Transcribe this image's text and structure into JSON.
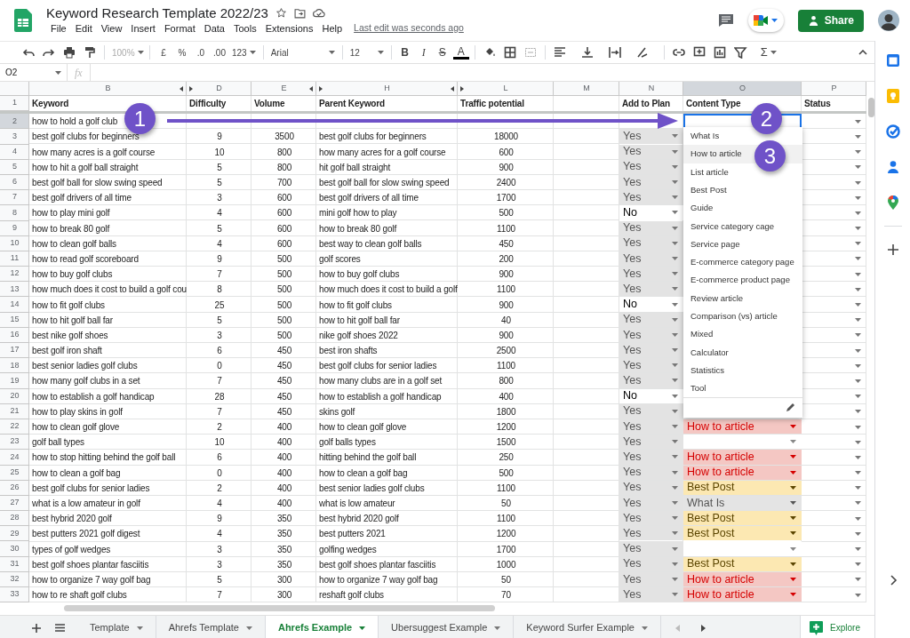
{
  "app": {
    "title": "Keyword Research Template 2022/23",
    "menu": [
      "File",
      "Edit",
      "View",
      "Insert",
      "Format",
      "Data",
      "Tools",
      "Extensions",
      "Help"
    ],
    "last_edit": "Last edit was seconds ago",
    "share": "Share"
  },
  "toolbar": {
    "zoom": "100%",
    "currency": "£",
    "percent": "%",
    "decimal_less": ".0",
    "decimal_more": ".00",
    "number_format": "123",
    "font": "Arial",
    "font_size": "12",
    "bold": "B",
    "italic": "I",
    "strike": "S",
    "text_color": "A",
    "sum": "Σ"
  },
  "formula_bar": {
    "cell_ref": "O2",
    "fx": "fx"
  },
  "sheet": {
    "columns": [
      {
        "letter": "B",
        "selected": false
      },
      {
        "letter": "D",
        "selected": false
      },
      {
        "letter": "E",
        "selected": false
      },
      {
        "letter": "H",
        "selected": false
      },
      {
        "letter": "L",
        "selected": false
      },
      {
        "letter": "M",
        "selected": false
      },
      {
        "letter": "N",
        "selected": false
      },
      {
        "letter": "O",
        "selected": true
      },
      {
        "letter": "P",
        "selected": false
      }
    ],
    "header_row": {
      "number": "1",
      "keyword": "Keyword",
      "difficulty": "Difficulty",
      "volume": "Volume",
      "parent": "Parent Keyword",
      "traffic": "Traffic potential",
      "plan": "Add to Plan",
      "content": "Content Type",
      "status": "Status"
    },
    "rows": [
      {
        "number": "2",
        "selected": true,
        "keyword": "how to hold a golf club"
      },
      {
        "number": "3",
        "selected": false,
        "keyword": "best golf clubs for beginners",
        "difficulty": "9",
        "volume": "3500",
        "parent": "best golf clubs for beginners",
        "traffic": "18000",
        "plan": {
          "text": "Yes",
          "shaded": true
        }
      },
      {
        "number": "4",
        "selected": false,
        "keyword": "how many acres is a golf course",
        "difficulty": "10",
        "volume": "800",
        "parent": "how many acres for a golf course",
        "traffic": "600",
        "plan": {
          "text": "Yes",
          "shaded": true
        }
      },
      {
        "number": "5",
        "selected": false,
        "keyword": "how to hit a golf ball straight",
        "difficulty": "5",
        "volume": "800",
        "parent": "hit golf ball straight",
        "traffic": "900",
        "plan": {
          "text": "Yes",
          "shaded": true
        }
      },
      {
        "number": "6",
        "selected": false,
        "keyword": "best golf ball for slow swing speed",
        "difficulty": "5",
        "volume": "700",
        "parent": "best golf ball for slow swing speed",
        "traffic": "2400",
        "plan": {
          "text": "Yes",
          "shaded": true
        }
      },
      {
        "number": "7",
        "selected": false,
        "keyword": "best golf drivers of all time",
        "difficulty": "3",
        "volume": "600",
        "parent": "best golf drivers of all time",
        "traffic": "1700",
        "plan": {
          "text": "Yes",
          "shaded": true
        }
      },
      {
        "number": "8",
        "selected": false,
        "keyword": "how to play mini golf",
        "difficulty": "4",
        "volume": "600",
        "parent": "mini golf how to play",
        "traffic": "500",
        "plan": {
          "text": "No",
          "shaded": false
        }
      },
      {
        "number": "9",
        "selected": false,
        "keyword": "how to break 80 golf",
        "difficulty": "5",
        "volume": "600",
        "parent": "how to break 80 golf",
        "traffic": "1100",
        "plan": {
          "text": "Yes",
          "shaded": true
        }
      },
      {
        "number": "10",
        "selected": false,
        "keyword": "how to clean golf balls",
        "difficulty": "4",
        "volume": "600",
        "parent": "best way to clean golf balls",
        "traffic": "450",
        "plan": {
          "text": "Yes",
          "shaded": true
        }
      },
      {
        "number": "11",
        "selected": false,
        "keyword": "how to read golf scoreboard",
        "difficulty": "9",
        "volume": "500",
        "parent": "golf scores",
        "traffic": "200",
        "plan": {
          "text": "Yes",
          "shaded": true
        }
      },
      {
        "number": "12",
        "selected": false,
        "keyword": "how to buy golf clubs",
        "difficulty": "7",
        "volume": "500",
        "parent": "how to buy golf clubs",
        "traffic": "900",
        "plan": {
          "text": "Yes",
          "shaded": true
        }
      },
      {
        "number": "13",
        "selected": false,
        "keyword": "how much does it cost to build a golf cou",
        "difficulty": "8",
        "volume": "500",
        "parent": "how much does it cost to build a golf",
        "traffic": "1100",
        "plan": {
          "text": "Yes",
          "shaded": true
        }
      },
      {
        "number": "14",
        "selected": false,
        "keyword": "how to fit golf clubs",
        "difficulty": "25",
        "volume": "500",
        "parent": "how to fit golf clubs",
        "traffic": "900",
        "plan": {
          "text": "No",
          "shaded": false
        }
      },
      {
        "number": "15",
        "selected": false,
        "keyword": "how to hit golf ball far",
        "difficulty": "5",
        "volume": "500",
        "parent": "how to hit golf ball far",
        "traffic": "40",
        "plan": {
          "text": "Yes",
          "shaded": true
        }
      },
      {
        "number": "16",
        "selected": false,
        "keyword": "best nike golf shoes",
        "difficulty": "3",
        "volume": "500",
        "parent": "nike golf shoes 2022",
        "traffic": "900",
        "plan": {
          "text": "Yes",
          "shaded": true
        }
      },
      {
        "number": "17",
        "selected": false,
        "keyword": "best golf iron shaft",
        "difficulty": "6",
        "volume": "450",
        "parent": "best iron shafts",
        "traffic": "2500",
        "plan": {
          "text": "Yes",
          "shaded": true
        }
      },
      {
        "number": "18",
        "selected": false,
        "keyword": "best senior ladies golf clubs",
        "difficulty": "0",
        "volume": "450",
        "parent": "best golf clubs for senior ladies",
        "traffic": "1100",
        "plan": {
          "text": "Yes",
          "shaded": true
        }
      },
      {
        "number": "19",
        "selected": false,
        "keyword": "how many golf clubs in a set",
        "difficulty": "7",
        "volume": "450",
        "parent": "how many clubs are in a golf set",
        "traffic": "800",
        "plan": {
          "text": "Yes",
          "shaded": true
        }
      },
      {
        "number": "20",
        "selected": false,
        "keyword": "how to establish a golf handicap",
        "difficulty": "28",
        "volume": "450",
        "parent": "how to establish a golf handicap",
        "traffic": "400",
        "plan": {
          "text": "No",
          "shaded": false
        }
      },
      {
        "number": "21",
        "selected": false,
        "keyword": "how to play skins in golf",
        "difficulty": "7",
        "volume": "450",
        "parent": "skins golf",
        "traffic": "1800",
        "plan": {
          "text": "Yes",
          "shaded": true
        }
      },
      {
        "number": "22",
        "selected": false,
        "keyword": "how to clean golf glove",
        "difficulty": "2",
        "volume": "400",
        "parent": "how to clean golf glove",
        "traffic": "1200",
        "plan": {
          "text": "Yes",
          "shaded": true
        },
        "content": {
          "text": "How to article",
          "kind": "howto"
        }
      },
      {
        "number": "23",
        "selected": false,
        "keyword": "golf ball types",
        "difficulty": "10",
        "volume": "400",
        "parent": "golf balls types",
        "traffic": "1500",
        "plan": {
          "text": "Yes",
          "shaded": true
        },
        "content": {
          "kind": "blank"
        }
      },
      {
        "number": "24",
        "selected": false,
        "keyword": "how to stop hitting behind the golf ball",
        "difficulty": "6",
        "volume": "400",
        "parent": "hitting behind the golf ball",
        "traffic": "250",
        "plan": {
          "text": "Yes",
          "shaded": true
        },
        "content": {
          "text": "How to article",
          "kind": "howto"
        }
      },
      {
        "number": "25",
        "selected": false,
        "keyword": "how to clean a golf bag",
        "difficulty": "0",
        "volume": "400",
        "parent": "how to clean a golf bag",
        "traffic": "500",
        "plan": {
          "text": "Yes",
          "shaded": true
        },
        "content": {
          "text": "How to article",
          "kind": "howto"
        }
      },
      {
        "number": "26",
        "selected": false,
        "keyword": "best golf clubs for senior ladies",
        "difficulty": "2",
        "volume": "400",
        "parent": "best senior ladies golf clubs",
        "traffic": "1100",
        "plan": {
          "text": "Yes",
          "shaded": true
        },
        "content": {
          "text": "Best Post",
          "kind": "bestpost"
        }
      },
      {
        "number": "27",
        "selected": false,
        "keyword": "what is a low amateur in golf",
        "difficulty": "4",
        "volume": "400",
        "parent": "what is low amateur",
        "traffic": "50",
        "plan": {
          "text": "Yes",
          "shaded": true
        },
        "content": {
          "text": "What Is",
          "kind": "whatis"
        }
      },
      {
        "number": "28",
        "selected": false,
        "keyword": "best hybrid 2020 golf",
        "difficulty": "9",
        "volume": "350",
        "parent": "best hybrid 2020 golf",
        "traffic": "1100",
        "plan": {
          "text": "Yes",
          "shaded": true
        },
        "content": {
          "text": "Best Post",
          "kind": "bestpost"
        }
      },
      {
        "number": "29",
        "selected": false,
        "keyword": "best putters 2021 golf digest",
        "difficulty": "4",
        "volume": "350",
        "parent": "best putters 2021",
        "traffic": "1200",
        "plan": {
          "text": "Yes",
          "shaded": true
        },
        "content": {
          "text": "Best Post",
          "kind": "bestpost"
        }
      },
      {
        "number": "30",
        "selected": false,
        "keyword": "types of golf wedges",
        "difficulty": "3",
        "volume": "350",
        "parent": "golfing wedges",
        "traffic": "1700",
        "plan": {
          "text": "Yes",
          "shaded": true
        },
        "content": {
          "kind": "blank"
        }
      },
      {
        "number": "31",
        "selected": false,
        "keyword": "best golf shoes plantar fasciitis",
        "difficulty": "3",
        "volume": "350",
        "parent": "best golf shoes plantar fasciitis",
        "traffic": "1000",
        "plan": {
          "text": "Yes",
          "shaded": true
        },
        "content": {
          "text": "Best Post",
          "kind": "bestpost"
        }
      },
      {
        "number": "32",
        "selected": false,
        "keyword": "how to organize 7 way golf bag",
        "difficulty": "5",
        "volume": "300",
        "parent": "how to organize 7 way golf bag",
        "traffic": "50",
        "plan": {
          "text": "Yes",
          "shaded": true
        },
        "content": {
          "text": "How to article",
          "kind": "howto"
        }
      },
      {
        "number": "33",
        "selected": false,
        "keyword": "how to re shaft golf clubs",
        "difficulty": "7",
        "volume": "300",
        "parent": "reshaft golf clubs",
        "traffic": "70",
        "plan": {
          "text": "Yes",
          "shaded": true
        },
        "content": {
          "text": "How to article",
          "kind": "howto"
        }
      }
    ]
  },
  "dropdown": {
    "items": [
      {
        "label": "What Is",
        "selected": false
      },
      {
        "label": "How to article",
        "selected": true
      },
      {
        "label": "List article",
        "selected": false
      },
      {
        "label": "Best Post",
        "selected": false
      },
      {
        "label": "Guide",
        "selected": false
      },
      {
        "label": "Service category cage",
        "selected": false
      },
      {
        "label": "Service page",
        "selected": false
      },
      {
        "label": "E-commerce category page",
        "selected": false
      },
      {
        "label": "E-commerce product page",
        "selected": false
      },
      {
        "label": "Review article",
        "selected": false
      },
      {
        "label": "Comparison (vs) article",
        "selected": false
      },
      {
        "label": "Mixed",
        "selected": false
      },
      {
        "label": "Calculator",
        "selected": false
      },
      {
        "label": "Statistics",
        "selected": false
      },
      {
        "label": "Tool",
        "selected": false
      }
    ]
  },
  "annotations": [
    {
      "label": "1"
    },
    {
      "label": "2"
    },
    {
      "label": "3"
    }
  ],
  "sheet_tabs": [
    {
      "label": "Template",
      "selected": false
    },
    {
      "label": "Ahrefs Template",
      "selected": false
    },
    {
      "label": "Ahrefs Example",
      "selected": true
    },
    {
      "label": "Ubersuggest Example",
      "selected": false
    },
    {
      "label": "Keyword Surfer Example",
      "selected": false
    }
  ],
  "explore": "Explore"
}
